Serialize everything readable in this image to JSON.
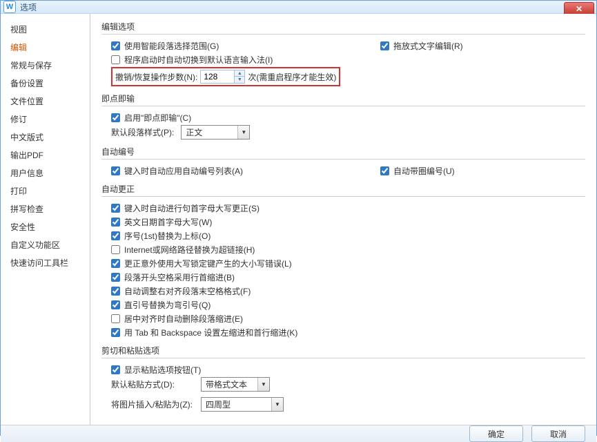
{
  "window": {
    "title": "选项"
  },
  "sidebar": {
    "items": [
      {
        "label": "视图"
      },
      {
        "label": "编辑"
      },
      {
        "label": "常规与保存"
      },
      {
        "label": "备份设置"
      },
      {
        "label": "文件位置"
      },
      {
        "label": "修订"
      },
      {
        "label": "中文版式"
      },
      {
        "label": "输出PDF"
      },
      {
        "label": "用户信息"
      },
      {
        "label": "打印"
      },
      {
        "label": "拼写检查"
      },
      {
        "label": "安全性"
      },
      {
        "label": "自定义功能区"
      },
      {
        "label": "快速访问工具栏"
      }
    ],
    "active_index": 1
  },
  "groups": {
    "edit_options": {
      "title": "编辑选项",
      "smart_paragraph_select": {
        "label": "使用智能段落选择范围(G)",
        "checked": true
      },
      "drag_text_edit": {
        "label": "拖放式文字编辑(R)",
        "checked": true
      },
      "switch_ime_on_startup": {
        "label": "程序启动时自动切换到默认语言输入法(I)",
        "checked": false
      },
      "undo_redo": {
        "label": "撤销/恢复操作步数(N):",
        "value": "128",
        "unit": "次",
        "note": "(需重启程序才能生效)"
      }
    },
    "click_type": {
      "title": "即点即输",
      "enable": {
        "label": "启用\"即点即输\"(C)",
        "checked": true
      },
      "default_para_style": {
        "label": "默认段落样式(P):",
        "value": "正文"
      }
    },
    "auto_number": {
      "title": "自动编号",
      "apply_list_on_type": {
        "label": "键入时自动应用自动编号列表(A)",
        "checked": true
      },
      "circled_number": {
        "label": "自动带圈编号(U)",
        "checked": true
      }
    },
    "auto_correct": {
      "title": "自动更正",
      "items": [
        {
          "label": "键入时自动进行句首字母大写更正(S)",
          "checked": true
        },
        {
          "label": "英文日期首字母大写(W)",
          "checked": true
        },
        {
          "label": "序号(1st)替换为上标(O)",
          "checked": true
        },
        {
          "label": "Internet或网络路径替换为超链接(H)",
          "checked": false
        },
        {
          "label": "更正意外使用大写锁定键产生的大小写错误(L)",
          "checked": true
        },
        {
          "label": "段落开头空格采用行首缩进(B)",
          "checked": true
        },
        {
          "label": "自动调整右对齐段落末空格格式(F)",
          "checked": true
        },
        {
          "label": "直引号替换为弯引号(Q)",
          "checked": true
        },
        {
          "label": "居中对齐时自动删除段落缩进(E)",
          "checked": false
        },
        {
          "label": "用 Tab 和 Backspace 设置左缩进和首行缩进(K)",
          "checked": true
        }
      ]
    },
    "cut_paste": {
      "title": "剪切和粘贴选项",
      "show_paste_options": {
        "label": "显示粘贴选项按钮(T)",
        "checked": true
      },
      "default_paste": {
        "label": "默认粘贴方式(D):",
        "value": "带格式文本"
      },
      "insert_picture": {
        "label": "将图片插入/粘贴为(Z):",
        "value": "四周型"
      }
    }
  },
  "buttons": {
    "ok": "确定",
    "cancel": "取消"
  }
}
